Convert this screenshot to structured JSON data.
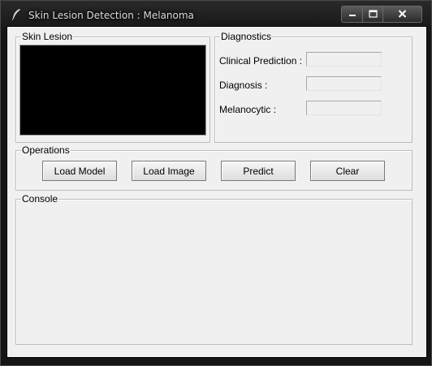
{
  "window": {
    "title": "Skin Lesion Detection : Melanoma",
    "icon": "feather-icon",
    "controls": [
      "minimize-icon",
      "maximize-icon",
      "close-icon"
    ]
  },
  "skin_lesion": {
    "label": "Skin Lesion"
  },
  "diagnostics": {
    "label": "Diagnostics",
    "fields": [
      {
        "label": "Clinical Prediction :",
        "value": ""
      },
      {
        "label": "Diagnosis :",
        "value": ""
      },
      {
        "label": "Melanocytic :",
        "value": ""
      }
    ]
  },
  "operations": {
    "label": "Operations",
    "buttons": [
      "Load Model",
      "Load Image",
      "Predict",
      "Clear"
    ]
  },
  "console": {
    "label": "Console",
    "text": ""
  },
  "colors": {
    "window_bg": "#f0f0f0",
    "canvas_bg": "#000000",
    "titlebar_bg": "#151515"
  }
}
